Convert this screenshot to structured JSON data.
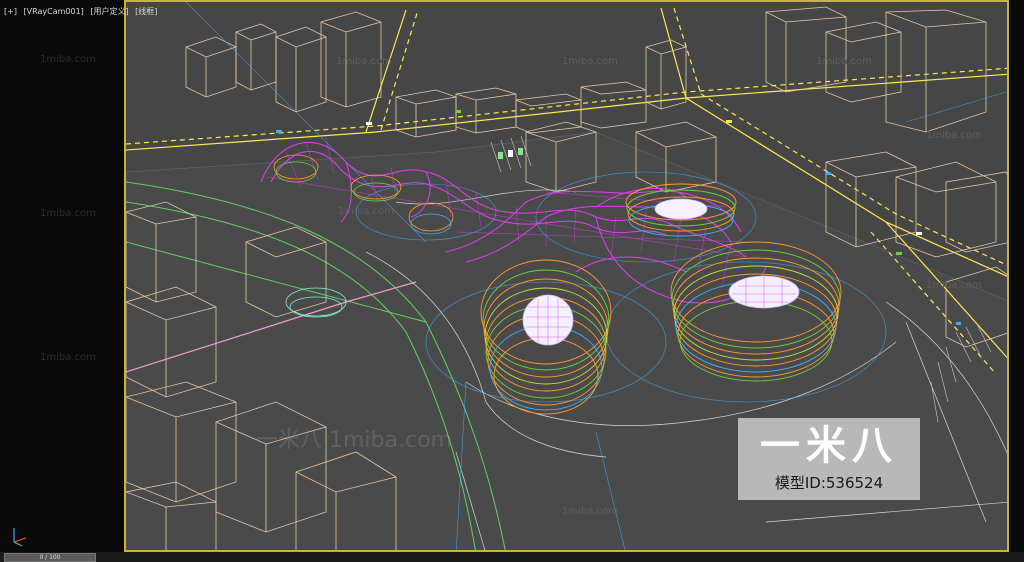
{
  "viewport_label": {
    "plus": "[+]",
    "camera": "[VRayCam001]",
    "view": "[用户定义]",
    "shading": "[线框]"
  },
  "watermarks": {
    "left_panel": [
      "1miba.com",
      "1miba.com",
      "1miba.com"
    ],
    "viewport": [
      "1miba.com",
      "1miba.com",
      "1miba.com",
      "1miba.com",
      "1miba.com",
      "1miba.com",
      "1miba.com"
    ],
    "bottom_text": "一米八 1miba.com"
  },
  "logo": {
    "chinese": "一米八",
    "model_id": "模型ID:536524"
  },
  "timeline": {
    "frame": "0 / 100"
  },
  "colors": {
    "viewport_bg": "#464646",
    "viewport_border": "#c9b43a",
    "buildings": "#e8c7a8",
    "roads_yellow": "#ffe94a",
    "roof_magenta": "#e23df0",
    "wire_orange": "#ff9a2a",
    "wire_green": "#6fd23c",
    "wire_blue": "#3ab0ff",
    "dome_white": "#eeeeff"
  }
}
